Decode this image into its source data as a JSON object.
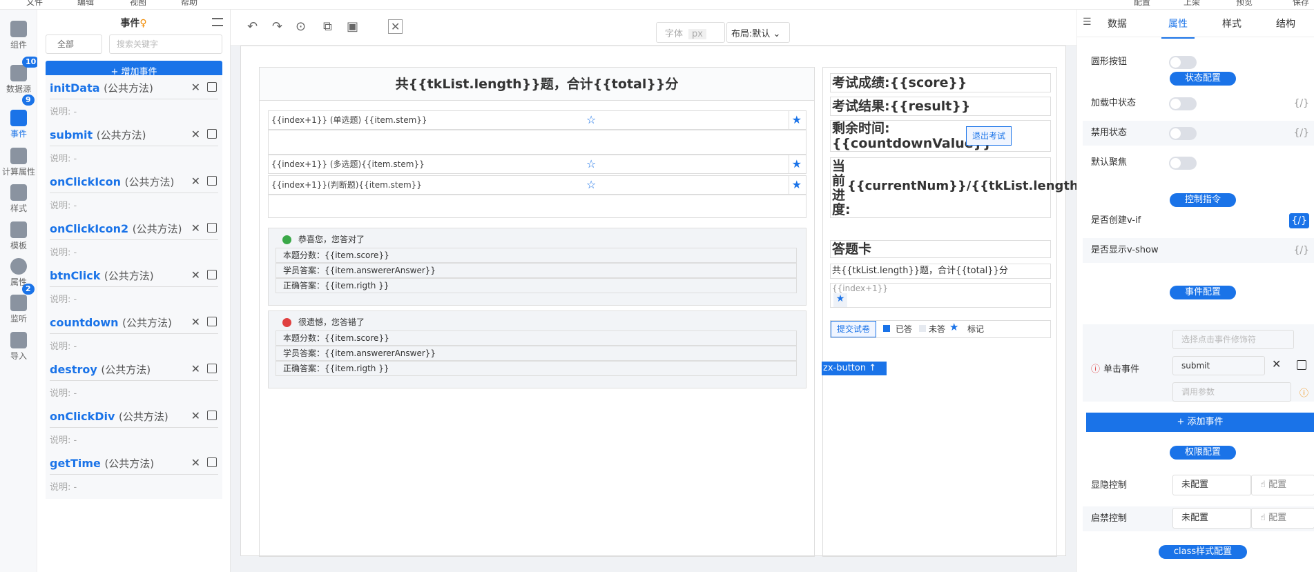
{
  "top_menu": [
    "文件",
    "编辑",
    "视图",
    "帮助",
    "配置",
    "上架",
    "预览",
    "保存"
  ],
  "rail": [
    {
      "label": "组件",
      "icon": "component-icon"
    },
    {
      "label": "数据源",
      "icon": "database-icon",
      "badge": "10"
    },
    {
      "label": "事件",
      "icon": "event-icon",
      "badge": "9"
    },
    {
      "label": "计算属性",
      "icon": "computed-icon"
    },
    {
      "label": "样式",
      "icon": "style-icon"
    },
    {
      "label": "模板",
      "icon": "template-icon"
    },
    {
      "label": "属性",
      "icon": "info-icon"
    },
    {
      "label": "监听",
      "icon": "watch-icon",
      "badge": "2"
    },
    {
      "label": "导入",
      "icon": "import-icon"
    }
  ],
  "events": {
    "title": "事件",
    "filter": "全部",
    "search_placeholder": "搜索关键字",
    "add_label": "+ 增加事件",
    "desc_label": "说明: -",
    "items": [
      {
        "name": "initData",
        "kind": "(公共方法)"
      },
      {
        "name": "submit",
        "kind": "(公共方法)"
      },
      {
        "name": "onClickIcon",
        "kind": "(公共方法)"
      },
      {
        "name": "onClickIcon2",
        "kind": "(公共方法)"
      },
      {
        "name": "btnClick",
        "kind": "(公共方法)"
      },
      {
        "name": "countdown",
        "kind": "(公共方法)"
      },
      {
        "name": "destroy",
        "kind": "(公共方法)"
      },
      {
        "name": "onClickDiv",
        "kind": "(公共方法)"
      },
      {
        "name": "getTime",
        "kind": "(公共方法)"
      }
    ]
  },
  "toolbar": {
    "font_placeholder": "字体",
    "font_unit": "px",
    "layout": "布局:默认"
  },
  "canvas": {
    "title": "共{{tkList.length}}题，合计{{total}}分",
    "q_single": "{{index+1}} (单选题) {{item.stem}}",
    "q_multi": "{{index+1}} (多选题){{item.stem}}",
    "q_judge": "{{index+1}}(判断题){{item.stem}}",
    "correct_title": "恭喜您，您答对了",
    "wrong_title": "很遗憾，您答错了",
    "score_row": "本题分数：{{item.score}}",
    "answer_row": "学员答案：{{item.answererAnswer}}",
    "right_row": "正确答案：{{item.rigth }}",
    "exam_score": "考试成绩:{{score}}",
    "exam_result": "考试结果:{{result}}",
    "remain": "剩余时间:{{countdownValue}}",
    "exit": "退出考试",
    "progress_label": "当前进度:",
    "progress_value": "{{currentNum}}/{{tkList.length}}",
    "card_title": "答题卡",
    "card_total": "共{{tkList.length}}题，合计{{total}}分",
    "card_index": "{{index+1}}",
    "tag": "zx-button",
    "submit": "提交试卷",
    "legend_answered": "已答",
    "legend_unanswered": "未答",
    "legend_marked": "标记"
  },
  "props": {
    "tabs": [
      "数据",
      "属性",
      "样式",
      "结构"
    ],
    "round_button": "圆形按钮",
    "sec_state": "状态配置",
    "loading": "加载中状态",
    "disabled": "禁用状态",
    "autofocus": "默认聚焦",
    "sec_directive": "控制指令",
    "vif": "是否创建v-if",
    "vshow": "是否显示v-show",
    "sec_event": "事件配置",
    "modifier_placeholder": "选择点击事件修饰符",
    "click_event": "单击事件",
    "click_value": "submit",
    "param_placeholder": "调用参数",
    "add_event": "+ 添加事件",
    "sec_perm": "权限配置",
    "visible_ctrl": "显隐控制",
    "enable_ctrl": "启禁控制",
    "not_configured": "未配置",
    "config_btn": "配置",
    "sec_class": "class样式配置",
    "bind_icon": "{/}"
  }
}
